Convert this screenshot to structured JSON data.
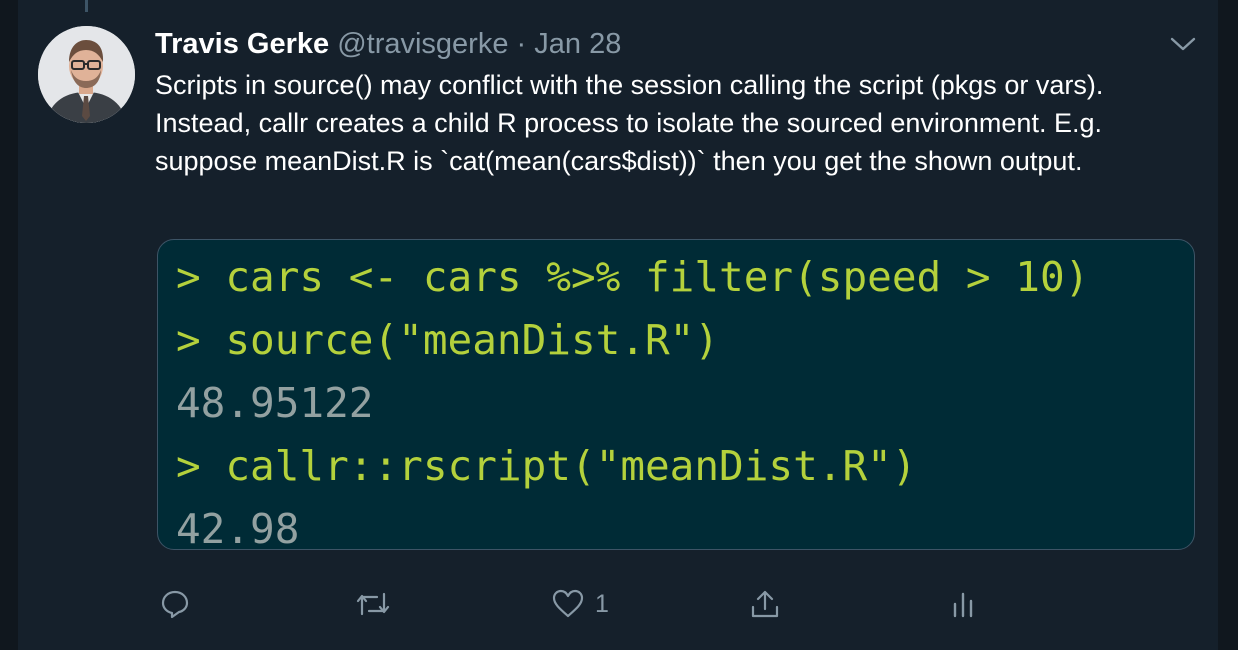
{
  "tweet": {
    "author_name": "Travis Gerke",
    "handle": "@travisgerke",
    "separator": "·",
    "date": "Jan 28",
    "text": "Scripts in source() may conflict with the session calling the script (pkgs or vars). Instead, callr creates a child R process to isolate the sourced environment. E.g. suppose meanDist.R is `cat(mean(cars$dist))` then you get the shown output."
  },
  "code_image": {
    "lines": [
      {
        "kind": "prompt",
        "text": "> cars <- cars %>% filter(speed > 10)"
      },
      {
        "kind": "prompt",
        "text": "> source(\"meanDist.R\")"
      },
      {
        "kind": "output",
        "text": "48.95122"
      },
      {
        "kind": "prompt",
        "text": "> callr::rscript(\"meanDist.R\")"
      },
      {
        "kind": "output",
        "text": "42.98"
      }
    ],
    "colors": {
      "background": "#002b36",
      "prompt": "#b4d13c",
      "output": "#93a1a1"
    }
  },
  "actions": {
    "reply_icon": "reply-icon",
    "retweet_icon": "retweet-icon",
    "like_icon": "heart-icon",
    "like_count": "1",
    "share_icon": "share-icon",
    "analytics_icon": "analytics-icon"
  },
  "theme": {
    "background": "#15202b",
    "text": "#ffffff",
    "muted": "#8899a6"
  }
}
